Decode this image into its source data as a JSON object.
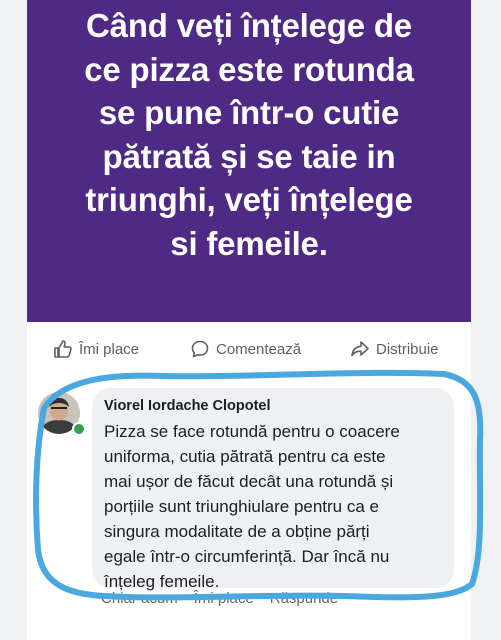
{
  "post": {
    "text": "Când veți înțelege de\nce pizza este rotunda\nse  pune într-o cutie\npătrată și se taie in\ntriunghi, veți înțelege\nsi femeile."
  },
  "actions": {
    "like_label": "Îmi place",
    "comment_label": "Comentează",
    "share_label": "Distribuie"
  },
  "comment": {
    "author": "Viorel Iordache Clopotel",
    "text": "Pizza se face rotundă  pentru o coacere\nuniforma, cutia pătrată pentru ca este\nmai  ușor de făcut decât una rotundă și\nporțiile sunt triunghiulare pentru ca e\nsingura modalitate de a obține părți\negale într-o circumferință.  Dar încă nu\nînțeleg femeile.",
    "time_label": "Chiar acum",
    "like_label": "Îmi place",
    "reply_label": "Răspunde"
  },
  "colors": {
    "banner": "#4e2a84",
    "highlight_stroke": "#4aa8e0",
    "online": "#31a24c"
  }
}
